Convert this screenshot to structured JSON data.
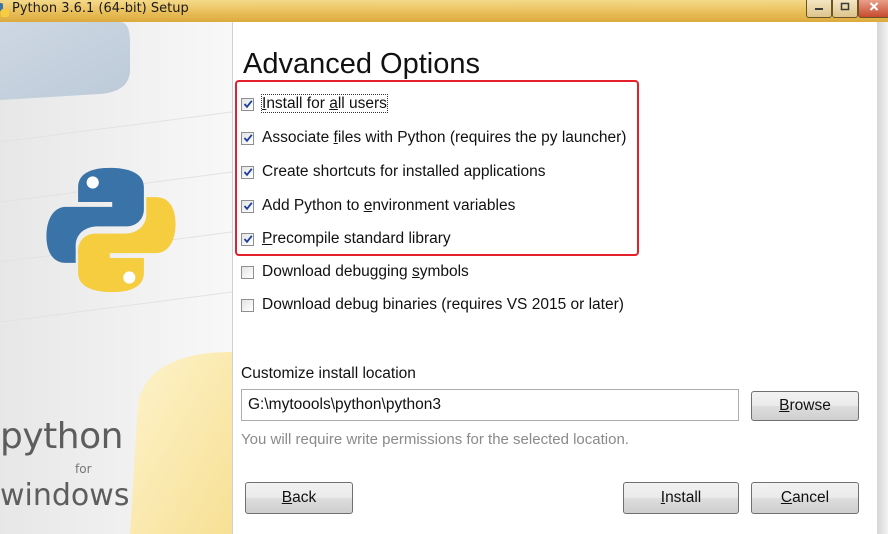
{
  "window": {
    "title": "Python 3.6.1 (64-bit) Setup",
    "controls": [
      "minimize-icon",
      "maximize-icon",
      "close-icon"
    ]
  },
  "branding": {
    "line1": "python",
    "line2": "for",
    "line3": "windows",
    "logo_colors": {
      "blue": "#3a73a8",
      "yellow": "#f5cd3f"
    }
  },
  "page": {
    "title": "Advanced Options"
  },
  "options": [
    {
      "pre": "",
      "ul": "I",
      "post": "nstall for ",
      "ul2": "a",
      "post2": "ll users",
      "checked": true,
      "focused": true
    },
    {
      "pre": "Associate ",
      "ul": "f",
      "post": "iles with Python (requires the py launcher)",
      "ul2": "",
      "post2": "",
      "checked": true,
      "focused": false
    },
    {
      "pre": "Create shortcuts for installed applications",
      "ul": "",
      "post": "",
      "ul2": "",
      "post2": "",
      "checked": true,
      "focused": false
    },
    {
      "pre": "Add Python to ",
      "ul": "e",
      "post": "nvironment variables",
      "ul2": "",
      "post2": "",
      "checked": true,
      "focused": false
    },
    {
      "pre": "",
      "ul": "P",
      "post": "recompile standard library",
      "ul2": "",
      "post2": "",
      "checked": true,
      "focused": false
    },
    {
      "pre": "Download debugging ",
      "ul": "s",
      "post": "ymbols",
      "ul2": "",
      "post2": "",
      "checked": false,
      "focused": false
    },
    {
      "pre": "Download debu",
      "ul": "g",
      "post": " binaries (requires VS 2015 or later)",
      "ul2": "",
      "post2": "",
      "checked": false,
      "focused": false
    }
  ],
  "location": {
    "label": "Customize install location",
    "value": "G:\\mytoools\\python\\python3",
    "hint": "You will require write permissions for the selected location.",
    "browse": {
      "ul": "B",
      "rest": "rowse"
    }
  },
  "buttons": {
    "back": {
      "ul": "B",
      "rest": "ack"
    },
    "install": {
      "ul": "I",
      "rest": "nstall"
    },
    "cancel": {
      "ul": "C",
      "rest": "ancel"
    }
  },
  "highlight_color": "#e4202a"
}
